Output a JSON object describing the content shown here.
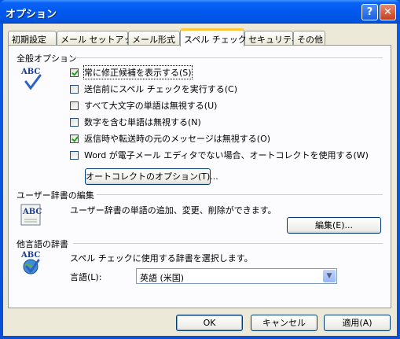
{
  "window": {
    "title": "オプション",
    "help_label": "?",
    "close_label": "✕"
  },
  "tabs": [
    {
      "label": "初期設定",
      "active": false
    },
    {
      "label": "メール セットアップ",
      "active": false
    },
    {
      "label": "メール形式",
      "active": false
    },
    {
      "label": "スペル チェック",
      "active": true
    },
    {
      "label": "セキュリティ",
      "active": false
    },
    {
      "label": "その他",
      "active": false
    }
  ],
  "general": {
    "title": "全般オプション",
    "icon_text": "ABC",
    "checkboxes": [
      {
        "label": "常に修正候補を表示する(S)",
        "checked": true
      },
      {
        "label": "送信前にスペル チェックを実行する(C)",
        "checked": false
      },
      {
        "label": "すべて大文字の単語は無視する(U)",
        "checked": false
      },
      {
        "label": "数字を含む単語は無視する(N)",
        "checked": false
      },
      {
        "label": "返信時や転送時の元のメッセージは無視する(O)",
        "checked": true
      },
      {
        "label": "Word が電子メール エディタでない場合、オートコレクトを使用する(W)",
        "checked": false
      }
    ],
    "autocorrect_button": "オートコレクトのオプション(T)..."
  },
  "user_dictionary": {
    "title": "ユーザー辞書の編集",
    "description": "ユーザー辞書の単語の追加、変更、削除ができます。",
    "edit_button": "編集(E)...",
    "icon_text": "ABC"
  },
  "other_language": {
    "title": "他言語の辞書",
    "description": "スペル チェックに使用する辞書を選択します。",
    "language_label": "言語(L):",
    "language_value": "英語 (米国)",
    "icon_text": "ABC"
  },
  "footer": {
    "ok": "OK",
    "cancel": "キャンセル",
    "apply": "適用(A)"
  }
}
